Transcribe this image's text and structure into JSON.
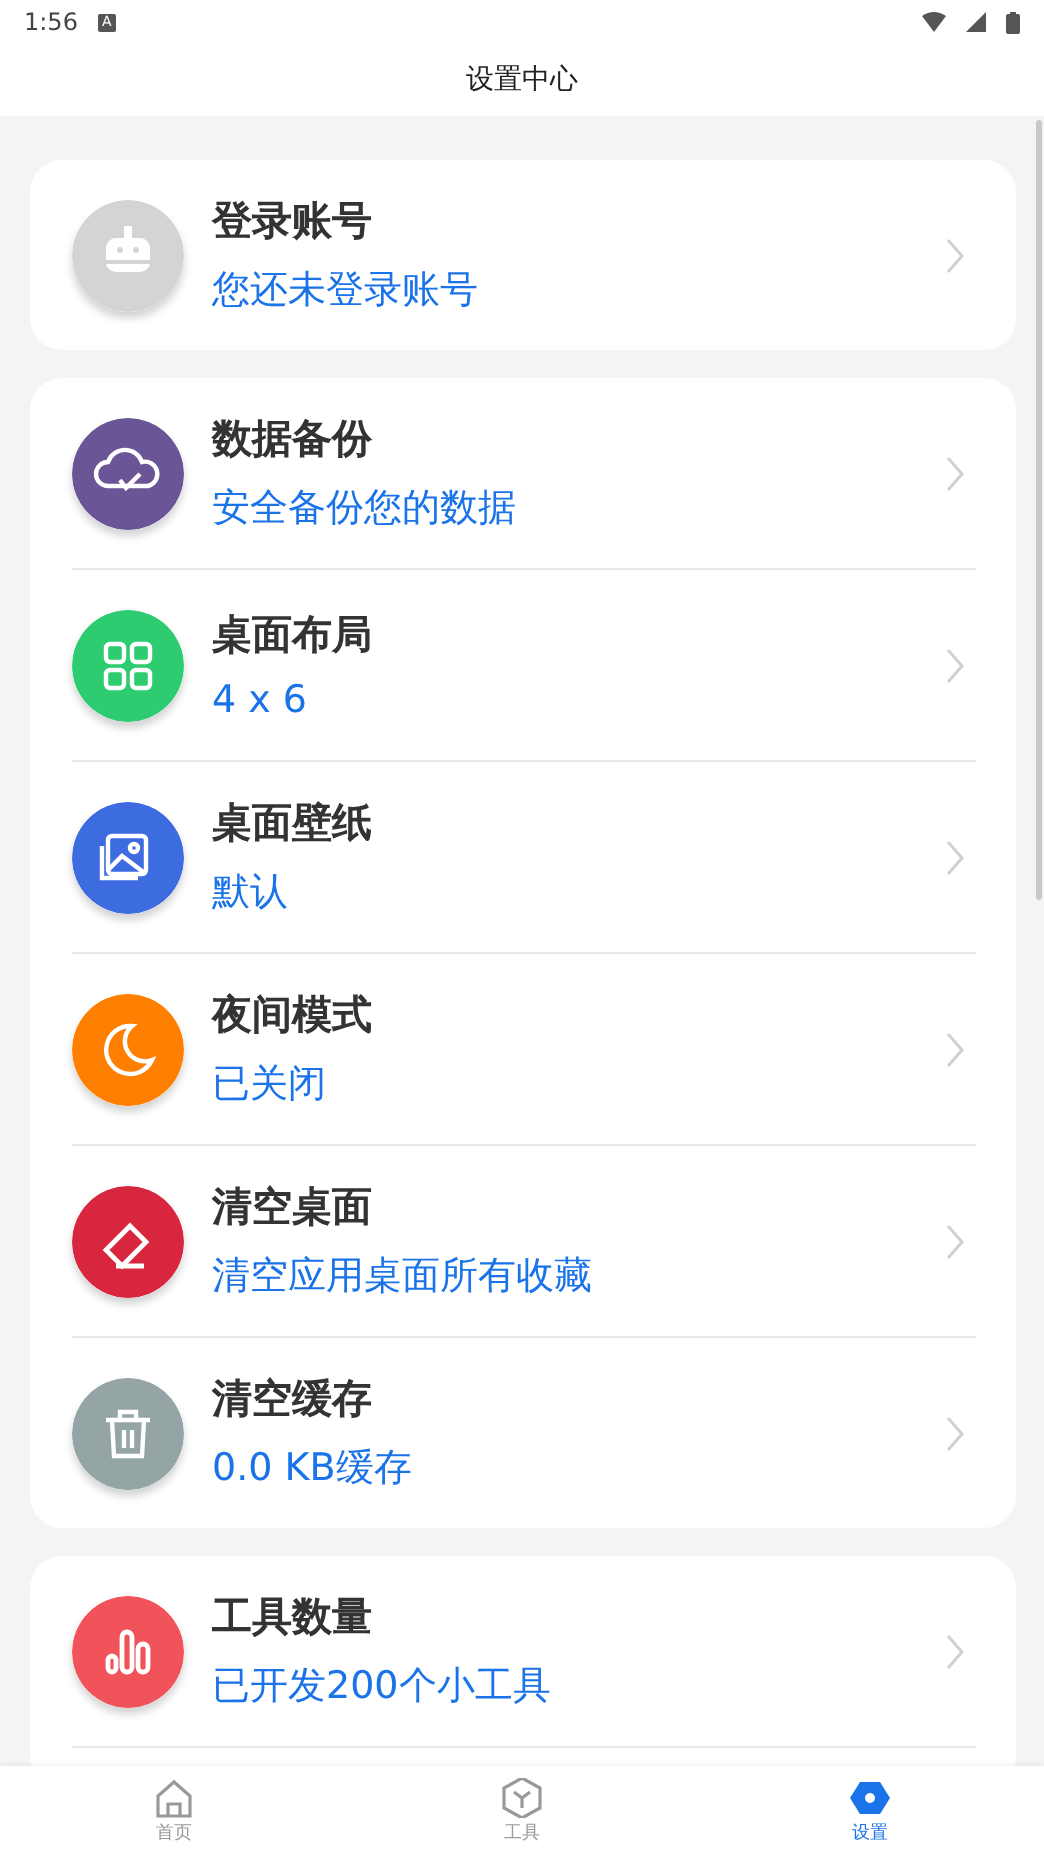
{
  "status_bar": {
    "time": "1:56",
    "notification": "A"
  },
  "header": {
    "title": "设置中心"
  },
  "groups": [
    {
      "items": [
        {
          "kind": "robot",
          "color": "#d4d4d4",
          "title": "登录账号",
          "subtitle": "您还未登录账号"
        }
      ]
    },
    {
      "items": [
        {
          "kind": "cloud",
          "color": "#6a5597",
          "title": "数据备份",
          "subtitle": "安全备份您的数据"
        },
        {
          "kind": "grid",
          "color": "#2ecc71",
          "title": "桌面布局",
          "subtitle": "4 x 6"
        },
        {
          "kind": "image",
          "color": "#3d6be0",
          "title": "桌面壁纸",
          "subtitle": "默认"
        },
        {
          "kind": "moon",
          "color": "#ff8000",
          "title": "夜间模式",
          "subtitle": "已关闭"
        },
        {
          "kind": "eraser",
          "color": "#d7263d",
          "title": "清空桌面",
          "subtitle": "清空应用桌面所有收藏"
        },
        {
          "kind": "trash",
          "color": "#95a5a6",
          "title": "清空缓存",
          "subtitle": "0.0 KB缓存"
        }
      ]
    },
    {
      "items": [
        {
          "kind": "bars",
          "color": "#f0545a",
          "title": "工具数量",
          "subtitle": "已开发200个小工具"
        }
      ]
    }
  ],
  "bottom_nav": [
    {
      "kind": "home",
      "label": "首页",
      "selected": false
    },
    {
      "kind": "tools",
      "label": "工具",
      "selected": false
    },
    {
      "kind": "settings",
      "label": "设置",
      "selected": true
    }
  ]
}
